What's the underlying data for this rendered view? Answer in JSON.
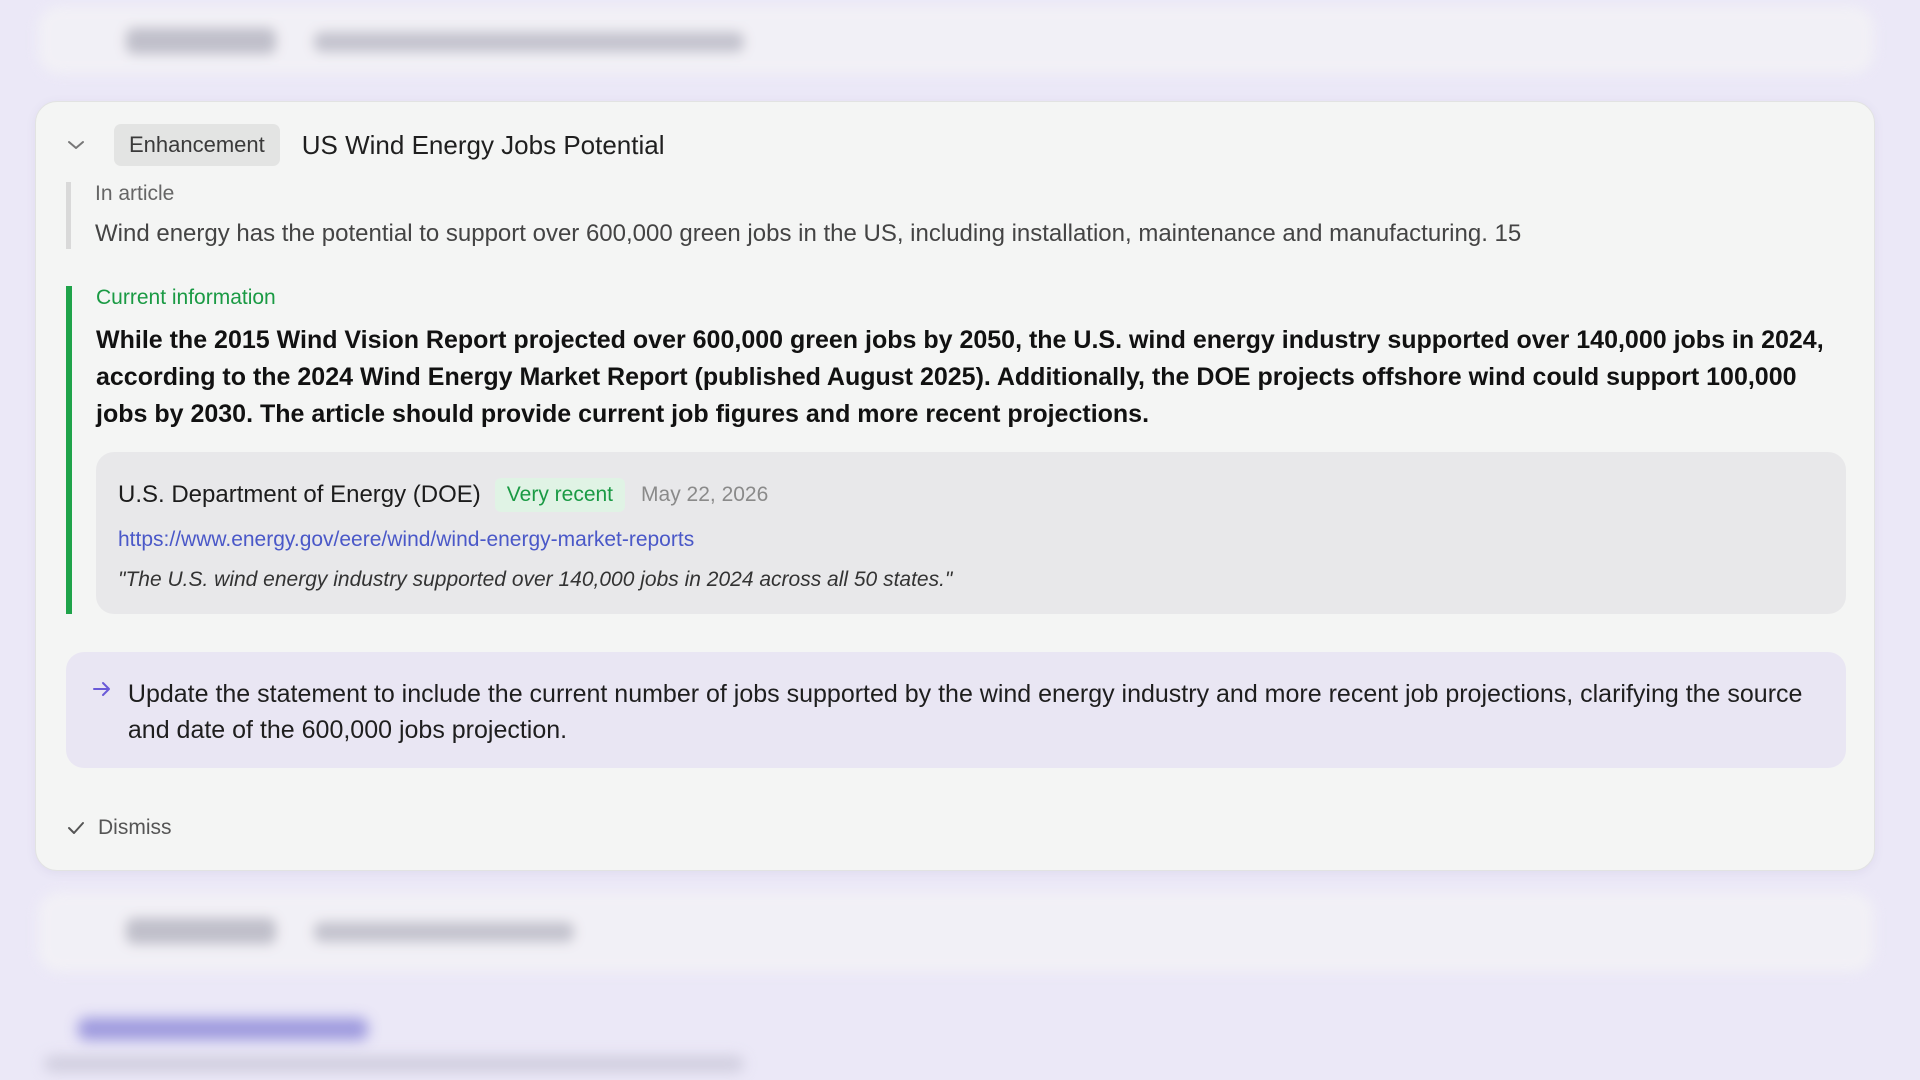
{
  "background": {
    "top_card": {
      "tag": "Enhancement",
      "title": "US Wind Energy Jobs Potential"
    },
    "bottom_card": {
      "tag": "Enhancement",
      "title": ""
    }
  },
  "card": {
    "tag": "Enhancement",
    "title": "US Wind Energy Jobs Potential",
    "in_article": {
      "label": "In article",
      "text": "Wind energy has the potential to support over 600,000 green jobs in the US, including installation, maintenance and manufacturing. 15"
    },
    "current_info": {
      "label": "Current information",
      "text": "While the 2015 Wind Vision Report projected over 600,000 green jobs by 2050, the U.S. wind energy industry supported over 140,000 jobs in 2024, according to the 2024 Wind Energy Market Report (published August 2025). Additionally, the DOE projects offshore wind could support 100,000 jobs by 2030. The article should provide current job figures and more recent projections."
    },
    "source": {
      "name": "U.S. Department of Energy (DOE)",
      "badge": "Very recent",
      "date": "May 22, 2026",
      "url": "https://www.energy.gov/eere/wind/wind-energy-market-reports",
      "quote": "\"The U.S. wind energy industry supported over 140,000 jobs in 2024 across all 50 states.\""
    },
    "suggestion": {
      "text": "Update the statement to include the current number of jobs supported by the wind energy industry and more recent job projections, clarifying the source and date of the 600,000 jobs projection."
    },
    "dismiss_label": "Dismiss"
  },
  "colors": {
    "accent_green": "#1fa34a",
    "link_blue": "#4a58c8",
    "suggestion_bg": "#e9e6f3",
    "page_bg": "#ebe8f7"
  },
  "icons": [
    "chevron-down-icon",
    "arrow-right-icon",
    "check-icon"
  ]
}
